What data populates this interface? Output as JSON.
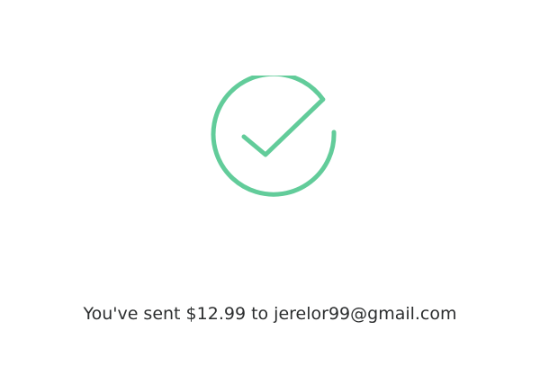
{
  "confirmation": {
    "icon": "checkmark-circle-icon",
    "accent_color": "#62cc9a",
    "message": "You've sent $12.99 to jerelor99@gmail.com"
  }
}
